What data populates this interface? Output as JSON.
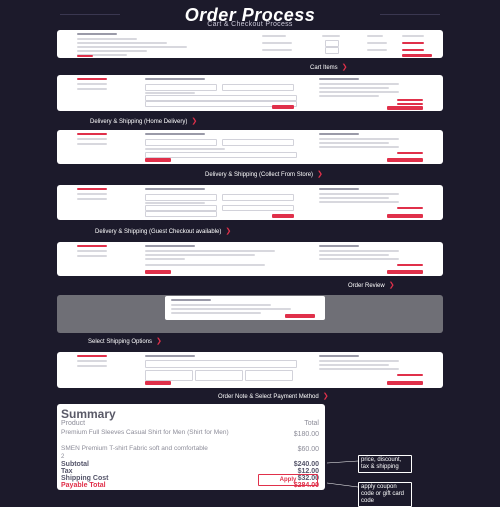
{
  "header": {
    "title": "Order Process",
    "subtitle": "Cart & Checkout Process"
  },
  "steps": [
    {
      "label": "Cart Items"
    },
    {
      "label": "Delivery & Shipping (Home Delivery)"
    },
    {
      "label": "Delivery & Shipping (Collect From Store)"
    },
    {
      "label": "Delivery & Shipping (Guest Checkout available)"
    },
    {
      "label": "Order Review"
    },
    {
      "label": "Select Shipping Options"
    },
    {
      "label": "Order Note & Select Payment Method"
    }
  ],
  "summary": {
    "heading": "Summary",
    "col_product": "Product",
    "col_total": "Total",
    "items": [
      {
        "name": "Premium Full Sleeves Casual Shirt for Men (Shirt for Men)",
        "total": "$180.00"
      },
      {
        "name": "SMEN Premium T-shirt Fabric soft and comfortable",
        "total": "$60.00"
      }
    ],
    "qty": "2",
    "subtotal_label": "Subtotal",
    "subtotal_value": "$240.00",
    "tax_label": "Tax",
    "tax_value": "$12.00",
    "shipping_label": "Shipping Cost",
    "shipping_value": "$32.00",
    "payable_label": "Payable Total",
    "payable_value": "$284.00",
    "apply_label": "Apply"
  },
  "callouts": [
    {
      "text": "price, discount, tax & shipping"
    },
    {
      "text": "apply coupon code or gift card code"
    }
  ],
  "colors": {
    "background": "#1c1a2b",
    "accent": "#e0304a",
    "panel": "#ffffff"
  }
}
